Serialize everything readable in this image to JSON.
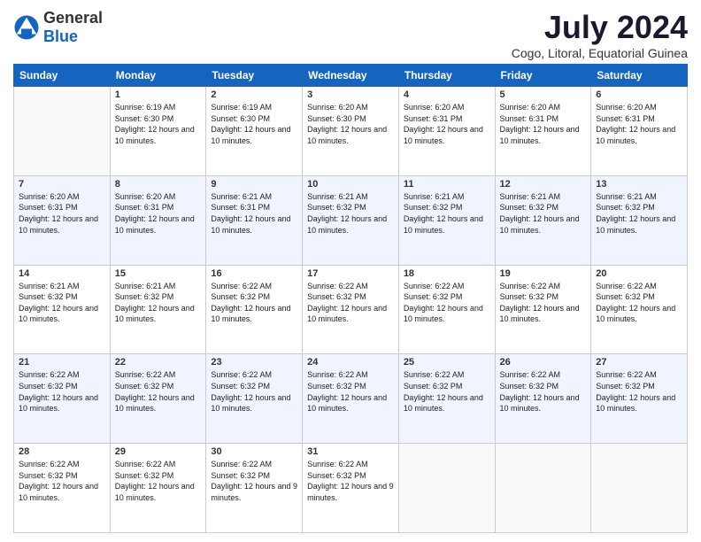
{
  "logo": {
    "general": "General",
    "blue": "Blue"
  },
  "header": {
    "month_year": "July 2024",
    "location": "Cogo, Litoral, Equatorial Guinea"
  },
  "weekdays": [
    "Sunday",
    "Monday",
    "Tuesday",
    "Wednesday",
    "Thursday",
    "Friday",
    "Saturday"
  ],
  "weeks": [
    [
      {
        "day": "",
        "sunrise": "",
        "sunset": "",
        "daylight": ""
      },
      {
        "day": "1",
        "sunrise": "Sunrise: 6:19 AM",
        "sunset": "Sunset: 6:30 PM",
        "daylight": "Daylight: 12 hours and 10 minutes."
      },
      {
        "day": "2",
        "sunrise": "Sunrise: 6:19 AM",
        "sunset": "Sunset: 6:30 PM",
        "daylight": "Daylight: 12 hours and 10 minutes."
      },
      {
        "day": "3",
        "sunrise": "Sunrise: 6:20 AM",
        "sunset": "Sunset: 6:30 PM",
        "daylight": "Daylight: 12 hours and 10 minutes."
      },
      {
        "day": "4",
        "sunrise": "Sunrise: 6:20 AM",
        "sunset": "Sunset: 6:31 PM",
        "daylight": "Daylight: 12 hours and 10 minutes."
      },
      {
        "day": "5",
        "sunrise": "Sunrise: 6:20 AM",
        "sunset": "Sunset: 6:31 PM",
        "daylight": "Daylight: 12 hours and 10 minutes."
      },
      {
        "day": "6",
        "sunrise": "Sunrise: 6:20 AM",
        "sunset": "Sunset: 6:31 PM",
        "daylight": "Daylight: 12 hours and 10 minutes."
      }
    ],
    [
      {
        "day": "7",
        "sunrise": "Sunrise: 6:20 AM",
        "sunset": "Sunset: 6:31 PM",
        "daylight": "Daylight: 12 hours and 10 minutes."
      },
      {
        "day": "8",
        "sunrise": "Sunrise: 6:20 AM",
        "sunset": "Sunset: 6:31 PM",
        "daylight": "Daylight: 12 hours and 10 minutes."
      },
      {
        "day": "9",
        "sunrise": "Sunrise: 6:21 AM",
        "sunset": "Sunset: 6:31 PM",
        "daylight": "Daylight: 12 hours and 10 minutes."
      },
      {
        "day": "10",
        "sunrise": "Sunrise: 6:21 AM",
        "sunset": "Sunset: 6:32 PM",
        "daylight": "Daylight: 12 hours and 10 minutes."
      },
      {
        "day": "11",
        "sunrise": "Sunrise: 6:21 AM",
        "sunset": "Sunset: 6:32 PM",
        "daylight": "Daylight: 12 hours and 10 minutes."
      },
      {
        "day": "12",
        "sunrise": "Sunrise: 6:21 AM",
        "sunset": "Sunset: 6:32 PM",
        "daylight": "Daylight: 12 hours and 10 minutes."
      },
      {
        "day": "13",
        "sunrise": "Sunrise: 6:21 AM",
        "sunset": "Sunset: 6:32 PM",
        "daylight": "Daylight: 12 hours and 10 minutes."
      }
    ],
    [
      {
        "day": "14",
        "sunrise": "Sunrise: 6:21 AM",
        "sunset": "Sunset: 6:32 PM",
        "daylight": "Daylight: 12 hours and 10 minutes."
      },
      {
        "day": "15",
        "sunrise": "Sunrise: 6:21 AM",
        "sunset": "Sunset: 6:32 PM",
        "daylight": "Daylight: 12 hours and 10 minutes."
      },
      {
        "day": "16",
        "sunrise": "Sunrise: 6:22 AM",
        "sunset": "Sunset: 6:32 PM",
        "daylight": "Daylight: 12 hours and 10 minutes."
      },
      {
        "day": "17",
        "sunrise": "Sunrise: 6:22 AM",
        "sunset": "Sunset: 6:32 PM",
        "daylight": "Daylight: 12 hours and 10 minutes."
      },
      {
        "day": "18",
        "sunrise": "Sunrise: 6:22 AM",
        "sunset": "Sunset: 6:32 PM",
        "daylight": "Daylight: 12 hours and 10 minutes."
      },
      {
        "day": "19",
        "sunrise": "Sunrise: 6:22 AM",
        "sunset": "Sunset: 6:32 PM",
        "daylight": "Daylight: 12 hours and 10 minutes."
      },
      {
        "day": "20",
        "sunrise": "Sunrise: 6:22 AM",
        "sunset": "Sunset: 6:32 PM",
        "daylight": "Daylight: 12 hours and 10 minutes."
      }
    ],
    [
      {
        "day": "21",
        "sunrise": "Sunrise: 6:22 AM",
        "sunset": "Sunset: 6:32 PM",
        "daylight": "Daylight: 12 hours and 10 minutes."
      },
      {
        "day": "22",
        "sunrise": "Sunrise: 6:22 AM",
        "sunset": "Sunset: 6:32 PM",
        "daylight": "Daylight: 12 hours and 10 minutes."
      },
      {
        "day": "23",
        "sunrise": "Sunrise: 6:22 AM",
        "sunset": "Sunset: 6:32 PM",
        "daylight": "Daylight: 12 hours and 10 minutes."
      },
      {
        "day": "24",
        "sunrise": "Sunrise: 6:22 AM",
        "sunset": "Sunset: 6:32 PM",
        "daylight": "Daylight: 12 hours and 10 minutes."
      },
      {
        "day": "25",
        "sunrise": "Sunrise: 6:22 AM",
        "sunset": "Sunset: 6:32 PM",
        "daylight": "Daylight: 12 hours and 10 minutes."
      },
      {
        "day": "26",
        "sunrise": "Sunrise: 6:22 AM",
        "sunset": "Sunset: 6:32 PM",
        "daylight": "Daylight: 12 hours and 10 minutes."
      },
      {
        "day": "27",
        "sunrise": "Sunrise: 6:22 AM",
        "sunset": "Sunset: 6:32 PM",
        "daylight": "Daylight: 12 hours and 10 minutes."
      }
    ],
    [
      {
        "day": "28",
        "sunrise": "Sunrise: 6:22 AM",
        "sunset": "Sunset: 6:32 PM",
        "daylight": "Daylight: 12 hours and 10 minutes."
      },
      {
        "day": "29",
        "sunrise": "Sunrise: 6:22 AM",
        "sunset": "Sunset: 6:32 PM",
        "daylight": "Daylight: 12 hours and 10 minutes."
      },
      {
        "day": "30",
        "sunrise": "Sunrise: 6:22 AM",
        "sunset": "Sunset: 6:32 PM",
        "daylight": "Daylight: 12 hours and 9 minutes."
      },
      {
        "day": "31",
        "sunrise": "Sunrise: 6:22 AM",
        "sunset": "Sunset: 6:32 PM",
        "daylight": "Daylight: 12 hours and 9 minutes."
      },
      {
        "day": "",
        "sunrise": "",
        "sunset": "",
        "daylight": ""
      },
      {
        "day": "",
        "sunrise": "",
        "sunset": "",
        "daylight": ""
      },
      {
        "day": "",
        "sunrise": "",
        "sunset": "",
        "daylight": ""
      }
    ]
  ]
}
